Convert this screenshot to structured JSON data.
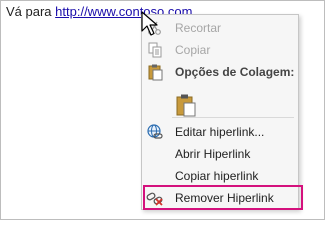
{
  "document": {
    "prefix": "Vá para ",
    "link": "http://www.contoso.com"
  },
  "menu": {
    "cut": "Recortar",
    "copy": "Copiar",
    "paste_options": "Opções de Colagem:",
    "edit_hyperlink": "Editar hiperlink...",
    "open_hyperlink": "Abrir Hiperlink",
    "copy_hyperlink": "Copiar hiperlink",
    "remove_hyperlink": "Remover Hiperlink"
  },
  "colors": {
    "link": "#1a0dab",
    "highlight": "#d4117d",
    "menu_bg": "#f6f6f6"
  },
  "icons": {
    "cut": "scissors-icon",
    "copy": "copy-icon",
    "paste": "clipboard-icon",
    "edit_hyperlink": "globe-link-icon",
    "remove_hyperlink": "unlink-icon",
    "cursor": "arrow-cursor-icon"
  }
}
